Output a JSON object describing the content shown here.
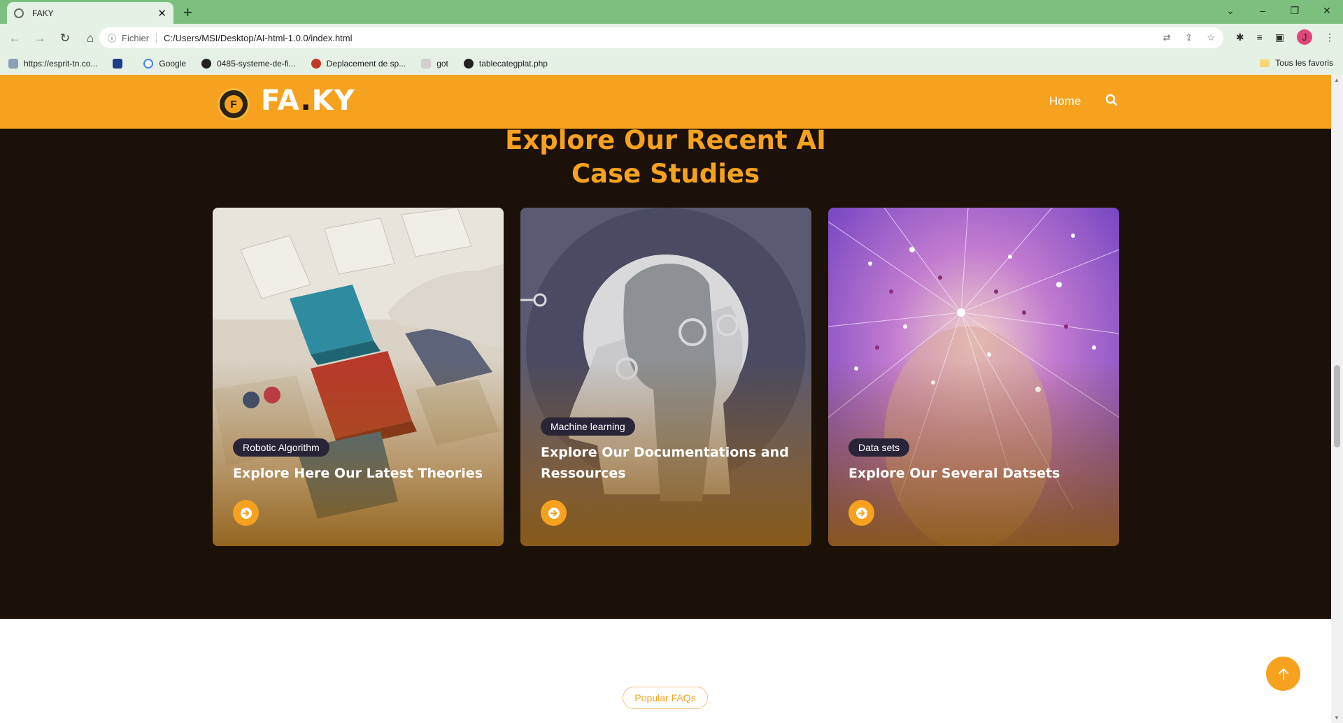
{
  "browser": {
    "tab_title": "FAKY",
    "scheme_label": "Fichier",
    "url": "C:/Users/MSI/Desktop/AI-html-1.0.0/index.html",
    "profile_initial": "J",
    "bookmarks": [
      {
        "label": "https://esprit-tn.co..."
      },
      {
        "label": ""
      },
      {
        "label": "Google"
      },
      {
        "label": "0485-systeme-de-fi..."
      },
      {
        "label": "Deplacement de sp..."
      },
      {
        "label": "got"
      },
      {
        "label": "tablecategplat.php"
      }
    ],
    "all_bookmarks_label": "Tous les favoris"
  },
  "site": {
    "logo_text_left": "FA",
    "logo_dot": ".",
    "logo_text_right": "KY",
    "nav_home": "Home"
  },
  "section": {
    "title_line1": "Explore Our Recent AI",
    "title_line2": "Case Studies"
  },
  "cards": [
    {
      "badge": "Robotic Algorithm",
      "title": "Explore Here Our Latest Theories"
    },
    {
      "badge": "Machine learning",
      "title": "Explore Our Documentations and Ressources"
    },
    {
      "badge": "Data sets",
      "title": "Explore Our Several Datsets"
    }
  ],
  "faq": {
    "label": "Popular FAQs"
  },
  "colors": {
    "accent": "#f7a21f",
    "dark_bg": "#1c1108",
    "badge_bg": "#2a2438",
    "chrome_green": "#7cbf7e"
  }
}
